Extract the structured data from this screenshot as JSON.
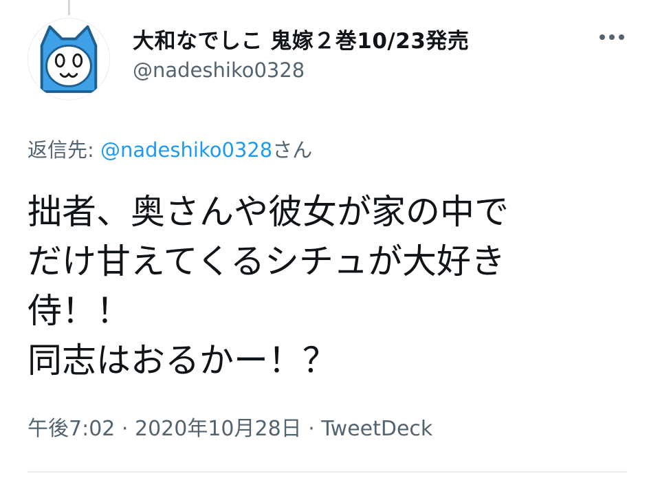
{
  "tweet": {
    "author": {
      "display_name": "大和なでしこ 鬼嫁２巻10/23発売",
      "handle": "@nadeshiko0328",
      "avatar": "cat-mascot-avatar"
    },
    "more_icon": "more-horizontal-icon",
    "reply_to": {
      "prefix": "返信先: ",
      "mention": "@nadeshiko0328",
      "suffix": "さん"
    },
    "text": "拙者、奥さんや彼女が家の中で\nだけ甘えてくるシチュが大好き\n侍！！\n同志はおるかー！？",
    "meta": {
      "time": "午後7:02",
      "separator": " · ",
      "date": "2020年10月28日",
      "source": "TweetDeck"
    }
  },
  "colors": {
    "text": "#0f1419",
    "secondary": "#536471",
    "link": "#1d9bf0",
    "avatar_blue": "#3ea0e6",
    "divider": "#e6ecf0"
  }
}
